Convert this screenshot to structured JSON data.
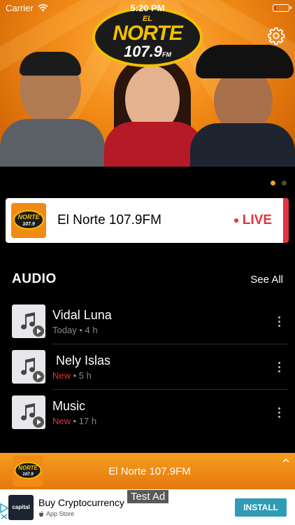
{
  "status": {
    "carrier": "Carrier",
    "time": "5:20 PM",
    "battery_level": 0.15
  },
  "hero": {
    "logo_top": "EL",
    "logo_main": "NORTE",
    "logo_freq": "107.9",
    "logo_unit": "FM",
    "gear_icon": "gear-icon",
    "pages_total": 2,
    "page_active": 1
  },
  "live": {
    "station_name": "El Norte 107.9FM",
    "badge": "LIVE"
  },
  "audio": {
    "title": "AUDIO",
    "see_all": "See All",
    "items": [
      {
        "name": "Vidal Luna",
        "tag": "Today",
        "age": "4 h",
        "tag_highlight": false
      },
      {
        "name": " Nely Islas",
        "tag": "New",
        "age": "5 h",
        "tag_highlight": true
      },
      {
        "name": "Music",
        "tag": "New",
        "age": "17 h",
        "tag_highlight": true
      }
    ]
  },
  "player": {
    "title": "El Norte 107.9FM"
  },
  "ad": {
    "label": "Test Ad",
    "advertiser_logo": "capital",
    "title": "Buy Cryptocurrency",
    "store": "App Store",
    "cta": "INSTALL"
  },
  "colors": {
    "accent": "#f59d20",
    "live": "#e2343f",
    "install": "#2f9bb6"
  }
}
